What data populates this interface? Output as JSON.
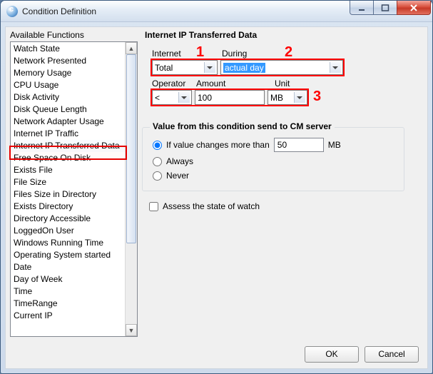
{
  "window": {
    "title": "Condition Definition"
  },
  "sidebar": {
    "heading": "Available Functions",
    "items": [
      "Watch State",
      "Network Presented",
      "Memory Usage",
      "CPU Usage",
      "Disk Activity",
      "Disk Queue Length",
      "Network Adapter Usage",
      "Internet IP Traffic",
      "Internet IP Transferred Data",
      "Free Space On Disk",
      "Exists File",
      "File Size",
      "Files Size in Directory",
      "Exists Directory",
      "Directory Accessible",
      "LoggedOn User",
      "Windows Running Time",
      "Operating System started",
      "Date",
      "Day of Week",
      "Time",
      "TimeRange",
      "Current IP"
    ],
    "selected_index": 8
  },
  "main": {
    "title": "Internet IP Transferred Data",
    "labels": {
      "internet": "Internet",
      "during": "During",
      "operator": "Operator",
      "amount": "Amount",
      "unit": "Unit"
    },
    "fields": {
      "internet_value": "Total",
      "during_value": "actual day",
      "operator_value": "<",
      "amount_value": "100",
      "unit_value": "MB"
    },
    "group": {
      "title": "Value from this condition send to CM server",
      "opt_changes": "If value changes more than",
      "opt_changes_value": "50",
      "opt_changes_unit": "MB",
      "opt_always": "Always",
      "opt_never": "Never"
    },
    "checkbox_label": "Assess the state of watch",
    "annotations": {
      "n1": "1",
      "n2": "2",
      "n3": "3"
    }
  },
  "buttons": {
    "ok": "OK",
    "cancel": "Cancel"
  }
}
